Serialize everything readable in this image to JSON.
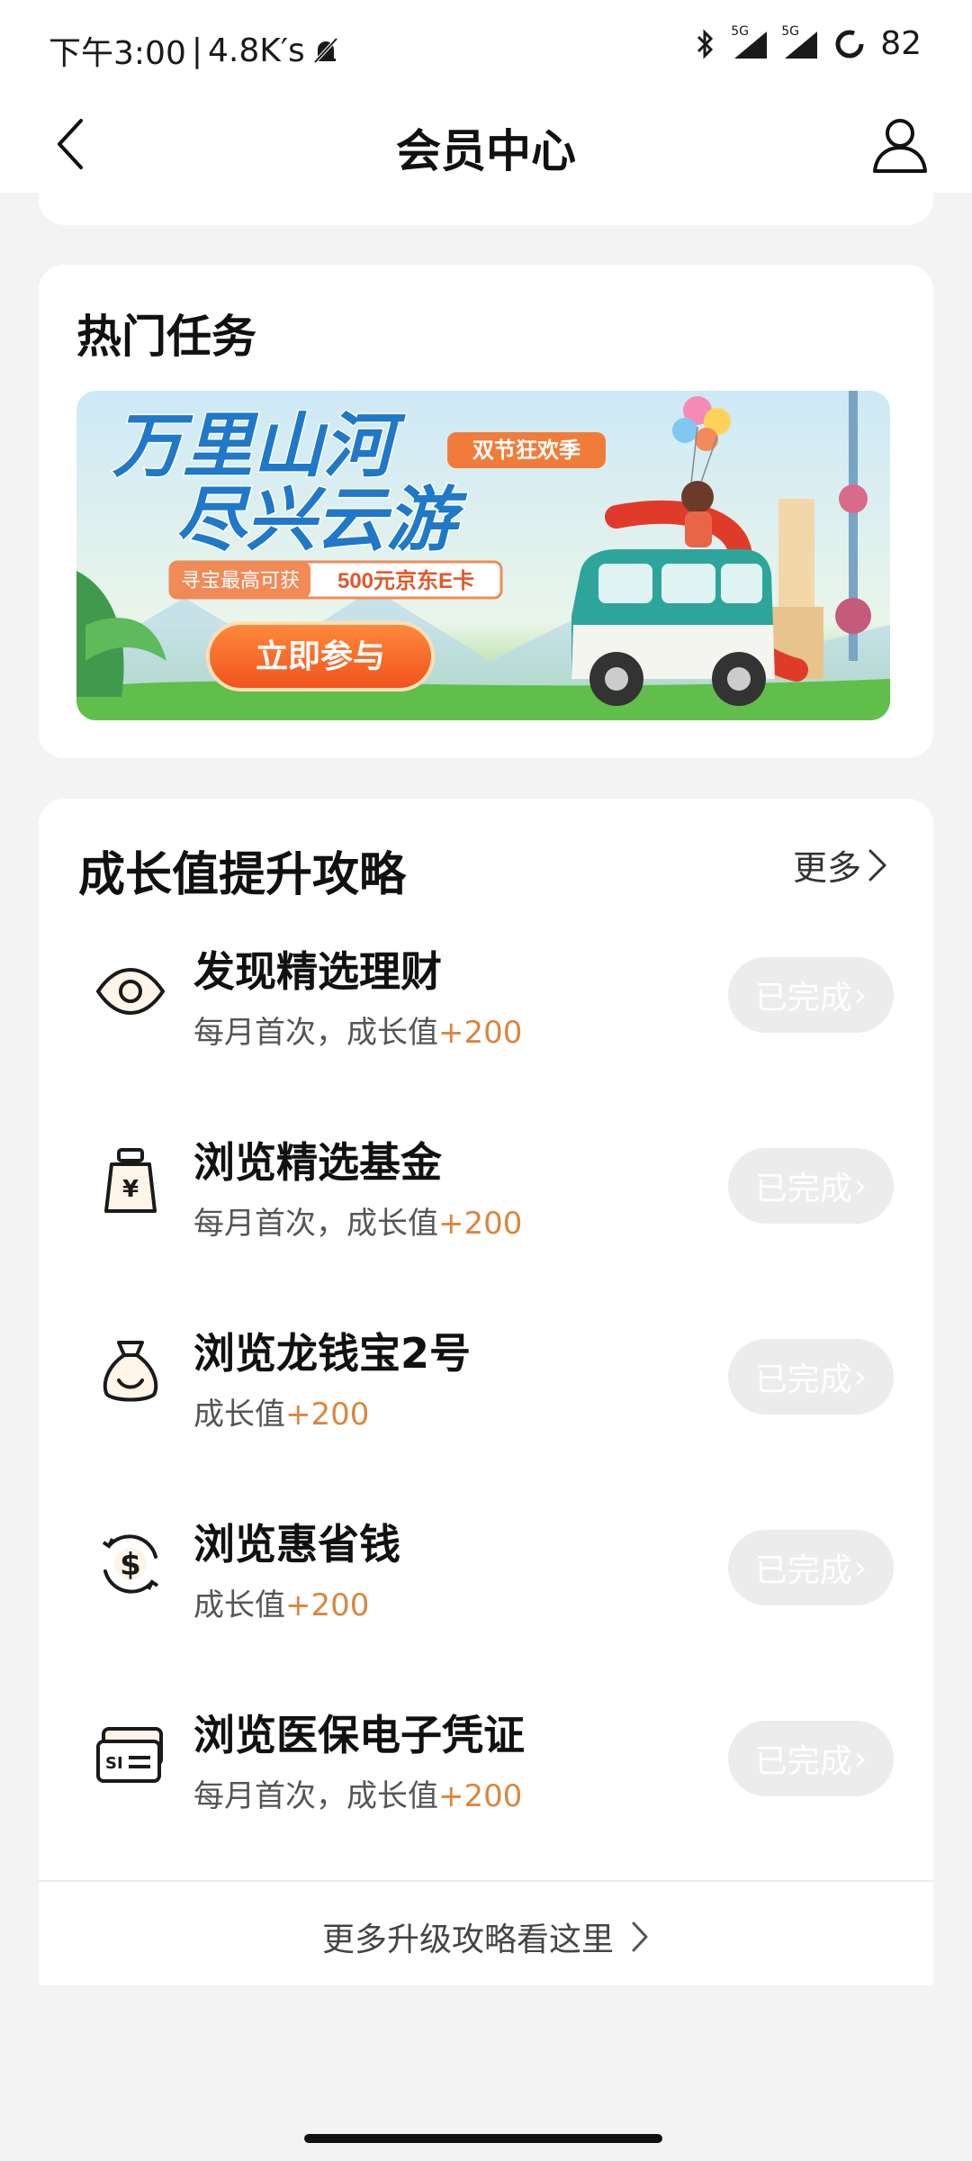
{
  "status_bar": {
    "time": "下午3:00",
    "speed": "4.8K′s",
    "signal1_tag": "5G",
    "signal2_tag": "5G",
    "battery": "82"
  },
  "nav": {
    "title": "会员中心"
  },
  "hot_tasks": {
    "heading": "热门任务",
    "banner": {
      "title_line1": "万里山河",
      "title_line2": "尽兴云游",
      "badge": "双节狂欢季",
      "promo_prefix": "寻宝最高可获",
      "promo_highlight": "500元京东E卡",
      "cta": "立即参与"
    }
  },
  "growth": {
    "heading": "成长值提升攻略",
    "more_label": "更多",
    "tasks": [
      {
        "name": "发现精选理财",
        "desc": "每月首次，成长值",
        "points": "+200",
        "button": "已完成",
        "icon": "eye-icon"
      },
      {
        "name": "浏览精选基金",
        "desc": "每月首次，成长值",
        "points": "+200",
        "button": "已完成",
        "icon": "money-jar-icon"
      },
      {
        "name": "浏览龙钱宝2号",
        "desc": "成长值",
        "points": "+200",
        "button": "已完成",
        "icon": "money-bag-icon"
      },
      {
        "name": "浏览惠省钱",
        "desc": "成长值",
        "points": "+200",
        "button": "已完成",
        "icon": "dollar-cycle-icon"
      },
      {
        "name": "浏览医保电子凭证",
        "desc": "每月首次，成长值",
        "points": "+200",
        "button": "已完成",
        "icon": "insurance-card-icon"
      }
    ],
    "footer_link": "更多升级攻略看这里"
  },
  "colors": {
    "accent_orange": "#d9873e",
    "disabled_button": "#ececec",
    "background": "#f3f3f3"
  }
}
